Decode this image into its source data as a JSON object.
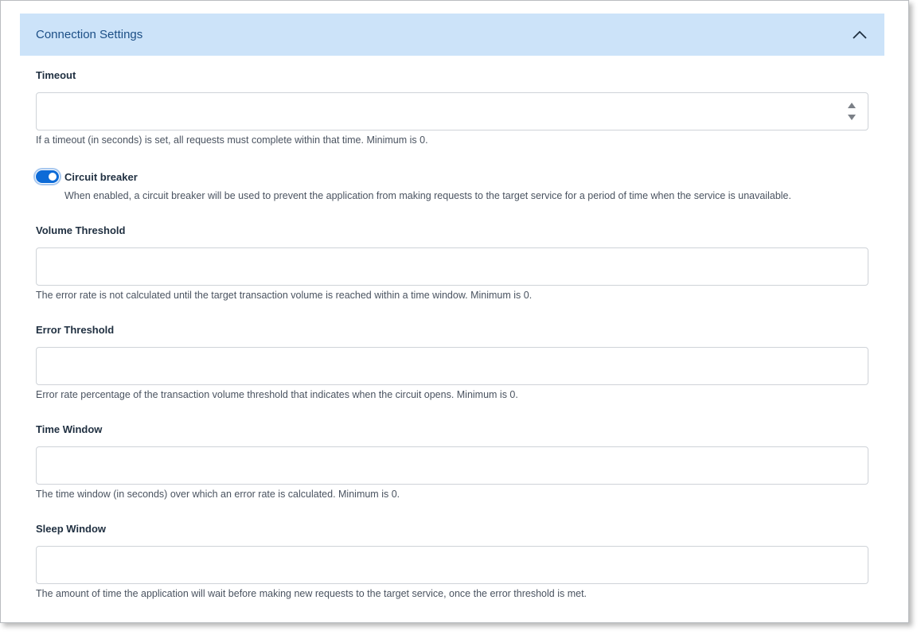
{
  "panel": {
    "title": "Connection Settings",
    "collapse_icon": "chevron-up-icon"
  },
  "timeout": {
    "label": "Timeout",
    "value": "",
    "help": "If a timeout (in seconds) is set, all requests must complete within that time. Minimum is 0."
  },
  "circuit_breaker": {
    "label": "Circuit breaker",
    "enabled": true,
    "help": "When enabled, a circuit breaker will be used to prevent the application from making requests to the target service for a period of time when the service is unavailable."
  },
  "volume_threshold": {
    "label": "Volume Threshold",
    "value": "",
    "help": "The error rate is not calculated until the target transaction volume is reached within a time window. Minimum is 0."
  },
  "error_threshold": {
    "label": "Error Threshold",
    "value": "",
    "help": "Error rate percentage of the transaction volume threshold that indicates when the circuit opens. Minimum is 0."
  },
  "time_window": {
    "label": "Time Window",
    "value": "",
    "help": "The time window (in seconds) over which an error rate is calculated. Minimum is 0."
  },
  "sleep_window": {
    "label": "Sleep Window",
    "value": "",
    "help": "The amount of time the application will wait before making new requests to the target service, once the error threshold is met."
  },
  "colors": {
    "header_bg": "#cce3f9",
    "header_text": "#1c4f86",
    "toggle_on": "#0d6bd7"
  }
}
